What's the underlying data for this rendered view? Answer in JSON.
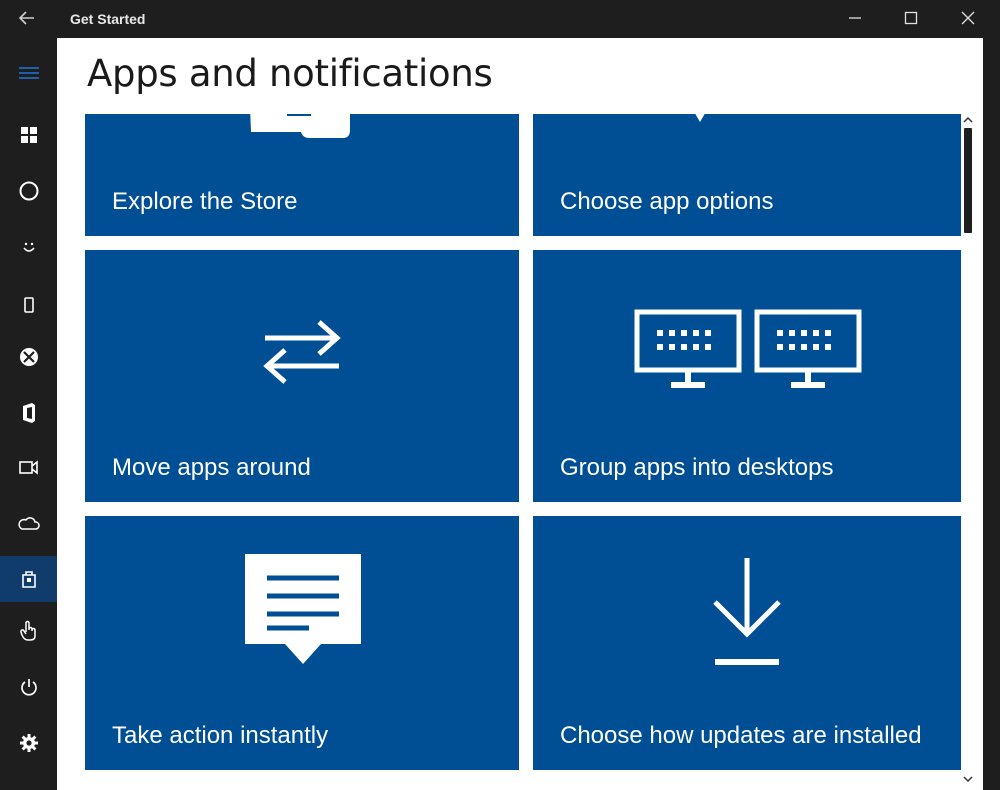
{
  "window": {
    "title": "Get Started"
  },
  "sidebar": {
    "items": [
      {
        "icon": "hamburger-menu-icon"
      },
      {
        "icon": "windows-logo-icon"
      },
      {
        "icon": "cortana-circle-icon"
      },
      {
        "icon": "smiley-icon"
      },
      {
        "icon": "phone-icon"
      },
      {
        "icon": "xbox-icon"
      },
      {
        "icon": "office-icon"
      },
      {
        "icon": "edge-browser-icon"
      },
      {
        "icon": "onedrive-cloud-icon"
      },
      {
        "icon": "store-bag-icon"
      },
      {
        "icon": "touch-hand-icon"
      },
      {
        "icon": "power-icon"
      },
      {
        "icon": "settings-gear-icon"
      }
    ],
    "active_index": 9
  },
  "page": {
    "title": "Apps and notifications"
  },
  "tiles": [
    {
      "label": "Explore the Store",
      "icon": "store-icon"
    },
    {
      "label": "Choose app options",
      "icon": "app-options-icon"
    },
    {
      "label": "Move apps around",
      "icon": "swap-arrows-icon"
    },
    {
      "label": "Group apps into desktops",
      "icon": "two-monitors-icon"
    },
    {
      "label": "Take action instantly",
      "icon": "notification-message-icon"
    },
    {
      "label": "Choose how updates are installed",
      "icon": "download-arrow-icon"
    }
  ],
  "colors": {
    "tile_blue": "#004e94",
    "chrome_dark": "#1e1e1e",
    "active_nav": "#0f3c6b"
  }
}
